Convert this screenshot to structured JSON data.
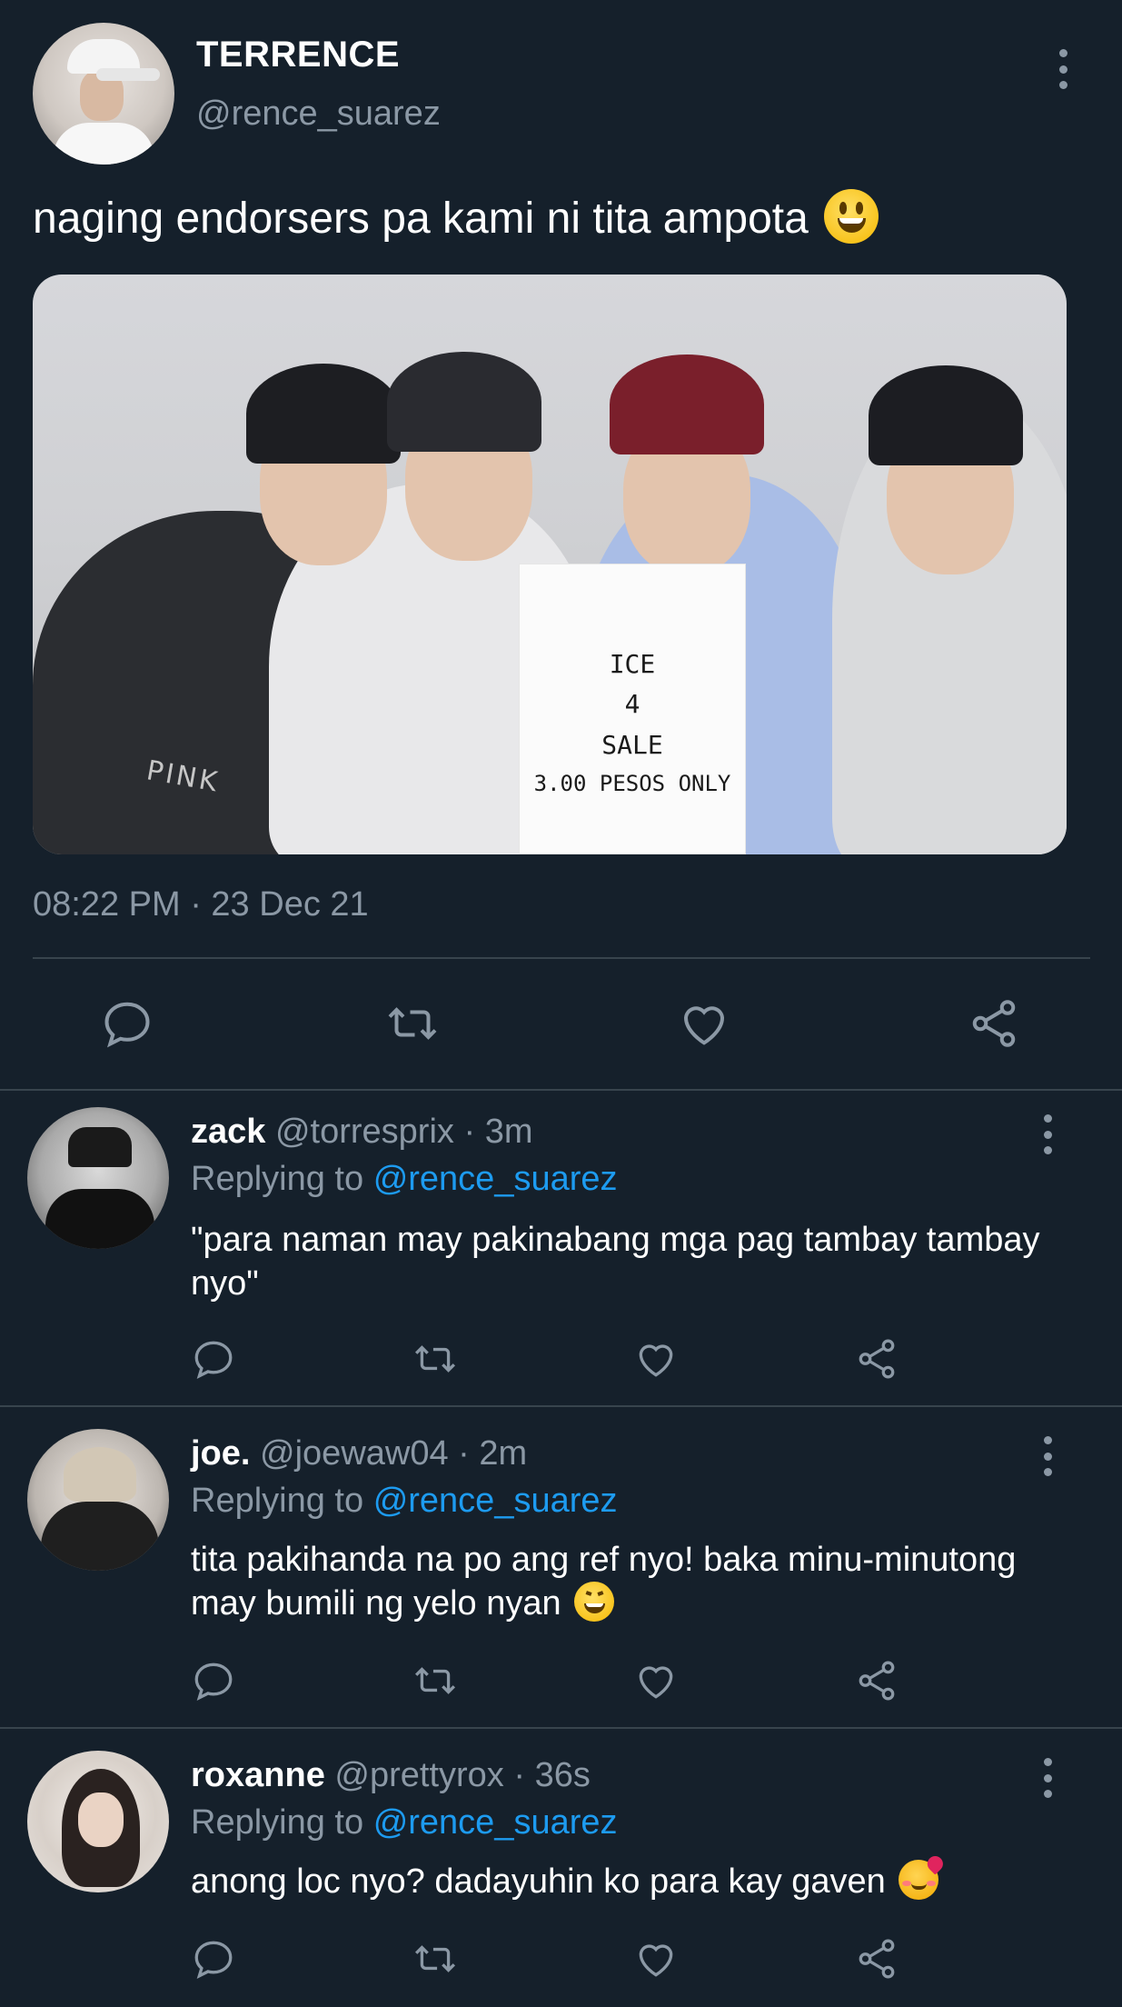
{
  "main_tweet": {
    "name": "TERRENCE",
    "handle": "@rence_suarez",
    "text": "naging endorsers pa kami ni tita ampota",
    "emoji": "grinning-face",
    "image": {
      "sign_lines": [
        "ICE",
        "4",
        "SALE",
        "3.00 PESOS ONLY"
      ],
      "shirt_text": "PINK"
    },
    "timestamp": "08:22 PM · 23 Dec 21",
    "actions": [
      "reply-icon",
      "retweet-icon",
      "like-icon",
      "share-icon"
    ]
  },
  "replies": [
    {
      "name": "zack",
      "handle": "@torresprix",
      "time": "3m",
      "replying_label": "Replying to",
      "mention": "@rence_suarez",
      "text": "\"para naman may pakinabang mga pag tambay tambay nyo\""
    },
    {
      "name": "joe.",
      "handle": "@joewaw04",
      "time": "2m",
      "replying_label": "Replying to",
      "mention": "@rence_suarez",
      "text": "tita pakihanda na po ang ref nyo! baka minu-minutong may bumili ng yelo nyan",
      "emoji": "grinning-squinting-face"
    },
    {
      "name": "roxanne",
      "handle": "@prettyrox",
      "time": "36s",
      "replying_label": "Replying to",
      "mention": "@rence_suarez",
      "text": "anong loc nyo? dadayuhin ko para kay gaven",
      "emoji": "smiling-face-with-hearts"
    }
  ],
  "colors": {
    "background": "#15202b",
    "secondary_text": "#8b98a5",
    "link": "#1d9bf0",
    "divider": "#38444d"
  }
}
